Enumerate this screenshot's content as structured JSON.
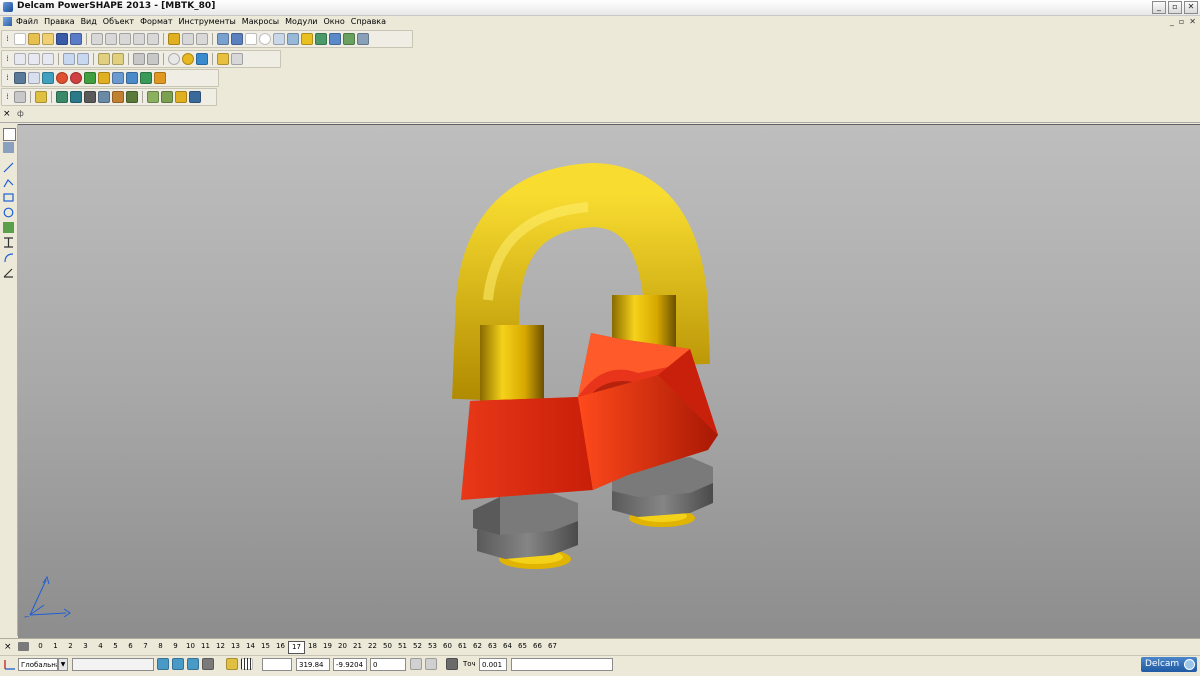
{
  "window": {
    "title": "Delcam PowerSHAPE 2013 - [MBTK_80]",
    "controls": [
      "_",
      "▫",
      "✕"
    ]
  },
  "menubar": {
    "items": [
      "Файл",
      "Правка",
      "Вид",
      "Объект",
      "Формат",
      "Инструменты",
      "Макросы",
      "Модули",
      "Окно",
      "Справка"
    ],
    "mdi_controls": [
      "_",
      "▫",
      "✕"
    ]
  },
  "tabbar": {
    "close": "×",
    "pin": "ф"
  },
  "colors": {
    "viewport_top": "#bebebe",
    "viewport_bottom": "#8d8d8d",
    "u_bolt": "#e0b400",
    "saddle": "#e02b10",
    "nut": "#6e6e6e",
    "triad": "#1e5fd4"
  },
  "levels": {
    "close": "×",
    "items": [
      "0",
      "1",
      "2",
      "3",
      "4",
      "5",
      "6",
      "7",
      "8",
      "9",
      "10",
      "11",
      "12",
      "13",
      "14",
      "15",
      "16",
      "17",
      "18",
      "19",
      "20",
      "21",
      "22",
      "50",
      "51",
      "52",
      "53",
      "60",
      "61",
      "62",
      "63",
      "64",
      "65",
      "66",
      "67"
    ],
    "active": "17"
  },
  "statusbar": {
    "workplane": "Глобальна",
    "coord_x": "319.84",
    "coord_y": "-9.9204",
    "coord_z": "0",
    "tolerance_label": "Точ",
    "tolerance_value": "0.001",
    "brand": "Delcam"
  }
}
